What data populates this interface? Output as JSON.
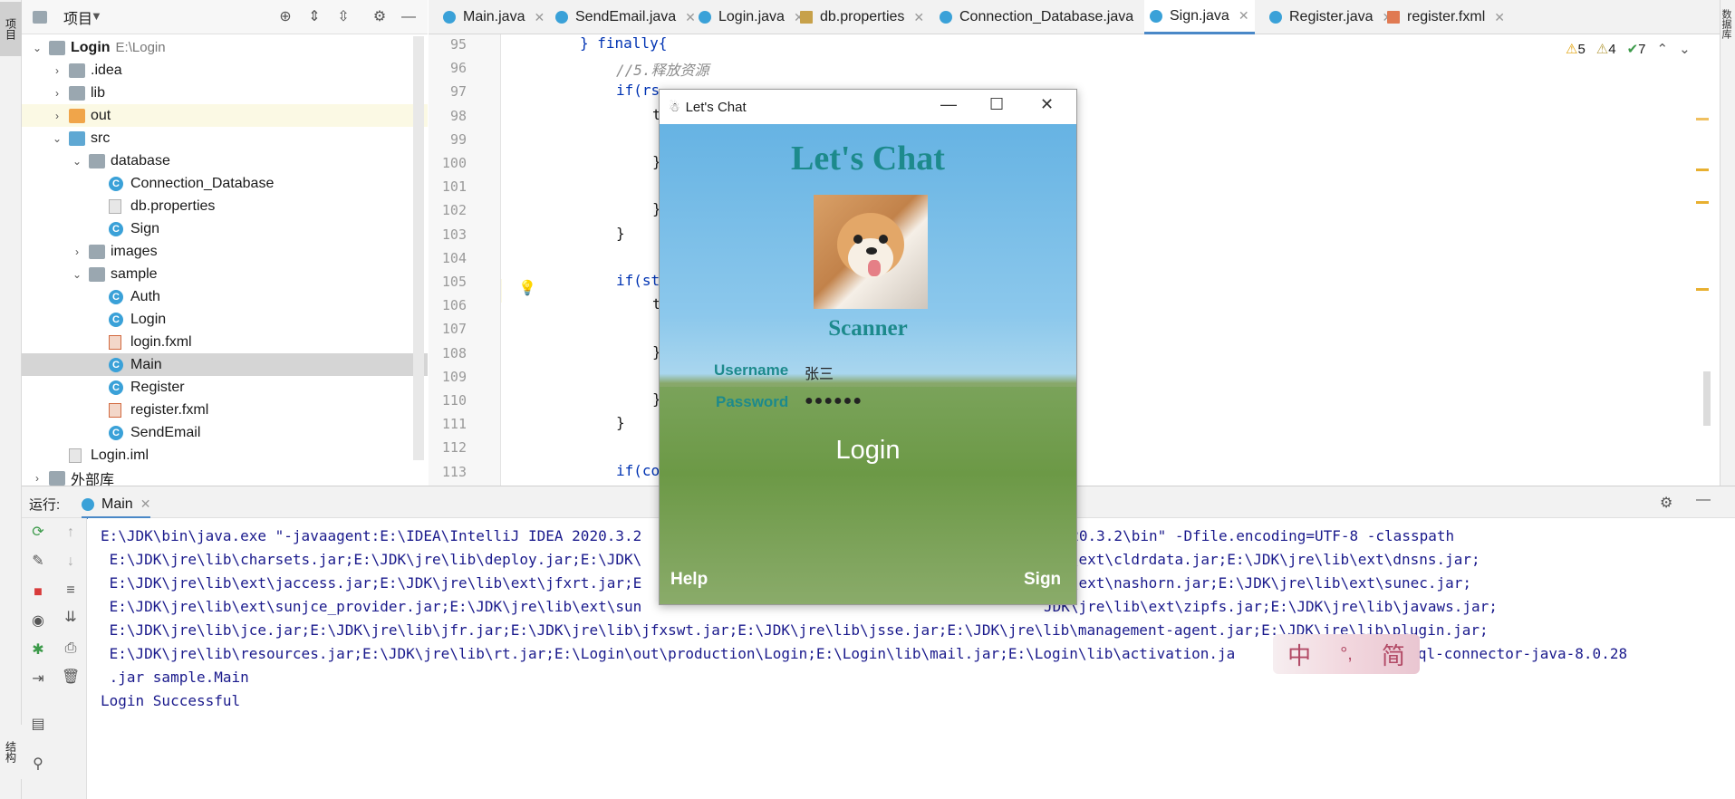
{
  "sidebar": {
    "project_tab": "项目",
    "structure_tab": "结构"
  },
  "project_panel": {
    "title": "项目",
    "tree": [
      {
        "label": "Login",
        "sub": "E:\\Login",
        "depth": 0,
        "expanded": true,
        "type": "module"
      },
      {
        "label": ".idea",
        "depth": 1,
        "expanded": false,
        "type": "folder"
      },
      {
        "label": "lib",
        "depth": 1,
        "expanded": false,
        "type": "folder"
      },
      {
        "label": "out",
        "depth": 1,
        "expanded": false,
        "type": "folder-orange"
      },
      {
        "label": "src",
        "depth": 1,
        "expanded": true,
        "type": "folder-blue"
      },
      {
        "label": "database",
        "depth": 2,
        "expanded": true,
        "type": "folder"
      },
      {
        "label": "Connection_Database",
        "depth": 3,
        "type": "class"
      },
      {
        "label": "db.properties",
        "depth": 3,
        "type": "props"
      },
      {
        "label": "Sign",
        "depth": 3,
        "type": "class"
      },
      {
        "label": "images",
        "depth": 2,
        "expanded": false,
        "type": "folder"
      },
      {
        "label": "sample",
        "depth": 2,
        "expanded": true,
        "type": "folder"
      },
      {
        "label": "Auth",
        "depth": 3,
        "type": "class"
      },
      {
        "label": "Login",
        "depth": 3,
        "type": "class"
      },
      {
        "label": "login.fxml",
        "depth": 3,
        "type": "fxml"
      },
      {
        "label": "Main",
        "depth": 3,
        "type": "class",
        "selected": true
      },
      {
        "label": "Register",
        "depth": 3,
        "type": "class"
      },
      {
        "label": "register.fxml",
        "depth": 3,
        "type": "fxml"
      },
      {
        "label": "SendEmail",
        "depth": 3,
        "type": "class"
      },
      {
        "label": "Login.iml",
        "depth": 1,
        "type": "iml"
      },
      {
        "label": "外部库",
        "depth": 0,
        "expanded": false,
        "type": "lib"
      }
    ]
  },
  "editor": {
    "tabs": [
      {
        "label": "Main.java",
        "icon": "class"
      },
      {
        "label": "SendEmail.java",
        "icon": "class"
      },
      {
        "label": "Login.java",
        "icon": "class"
      },
      {
        "label": "db.properties",
        "icon": "props"
      },
      {
        "label": "Connection_Database.java",
        "icon": "class"
      },
      {
        "label": "Sign.java",
        "icon": "class",
        "active": true
      },
      {
        "label": "Register.java",
        "icon": "class"
      },
      {
        "label": "register.fxml",
        "icon": "fxml"
      }
    ],
    "inspections": {
      "warnings": "5",
      "weak_warnings": "4",
      "ok": "7"
    },
    "line_numbers": [
      "95",
      "96",
      "97",
      "98",
      "99",
      "100",
      "101",
      "102",
      "103",
      "104",
      "105",
      "106",
      "107",
      "108",
      "109",
      "110",
      "111",
      "112",
      "113"
    ],
    "code_lines": [
      {
        "kind": "finally",
        "text": "} finally{"
      },
      {
        "kind": "comment",
        "text": "//5.释放资源"
      },
      {
        "kind": "code",
        "text": "if(rs"
      },
      {
        "kind": "code",
        "text": "t"
      },
      {
        "kind": "code",
        "text": ""
      },
      {
        "kind": "code",
        "text": "}"
      },
      {
        "kind": "code",
        "text": ""
      },
      {
        "kind": "code",
        "text": "}"
      },
      {
        "kind": "code",
        "text": "}"
      },
      {
        "kind": "code",
        "text": ""
      },
      {
        "kind": "code",
        "text": "if(st"
      },
      {
        "kind": "code",
        "text": "t"
      },
      {
        "kind": "code",
        "text": ""
      },
      {
        "kind": "code",
        "text": "}"
      },
      {
        "kind": "code",
        "text": ""
      },
      {
        "kind": "code",
        "text": "}"
      },
      {
        "kind": "code",
        "text": "}"
      },
      {
        "kind": "code",
        "text": ""
      },
      {
        "kind": "code",
        "text": "if(co"
      }
    ]
  },
  "run_panel": {
    "label": "运行:",
    "tab": "Main",
    "console_lines": [
      "E:\\JDK\\bin\\java.exe \"-javaagent:E:\\IDEA\\IntelliJ IDEA 2020.3.2",
      " E:\\JDK\\jre\\lib\\charsets.jar;E:\\JDK\\jre\\lib\\deploy.jar;E:\\JDK\\",
      " E:\\JDK\\jre\\lib\\ext\\jaccess.jar;E:\\JDK\\jre\\lib\\ext\\jfxrt.jar;E",
      " E:\\JDK\\jre\\lib\\ext\\sunjce_provider.jar;E:\\JDK\\jre\\lib\\ext\\sun",
      " E:\\JDK\\jre\\lib\\jce.jar;E:\\JDK\\jre\\lib\\jfr.jar;E:\\JDK\\jre\\lib\\jfxswt.jar;E:\\JDK\\jre\\lib\\jsse.jar;E:\\JDK\\jre\\lib\\management-agent.jar;E:\\JDK\\jre\\lib\\plugin.jar;",
      " E:\\JDK\\jre\\lib\\resources.jar;E:\\JDK\\jre\\lib\\rt.jar;E:\\Login\\out\\production\\Login;E:\\Login\\lib\\mail.jar;E:\\Login\\lib\\activation.ja",
      " .jar sample.Main",
      "Login Successful"
    ],
    "console_right": [
      "2020.3.2\\bin\" -Dfile.encoding=UTF-8 -classpath",
      "lib\\ext\\cldrdata.jar;E:\\JDK\\jre\\lib\\ext\\dnsns.jar;",
      "lib\\ext\\nashorn.jar;E:\\JDK\\jre\\lib\\ext\\sunec.jar;",
      "JDK\\jre\\lib\\ext\\zipfs.jar;E:\\JDK\\jre\\lib\\javaws.jar;",
      "mysql-connector-java-8.0.28"
    ]
  },
  "dialog": {
    "title": "Let's Chat",
    "heading": "Let's Chat",
    "name": "Scanner",
    "username_label": "Username",
    "username_value": "张三",
    "password_label": "Password",
    "password_value": "●●●●●●",
    "login_label": "Login",
    "help_label": "Help",
    "sign_label": "Sign",
    "colors": {
      "heading": "#1d8a8c",
      "link": "#ffffff"
    }
  },
  "ime": {
    "mode": "中",
    "sep": "°,",
    "variant": "简"
  }
}
